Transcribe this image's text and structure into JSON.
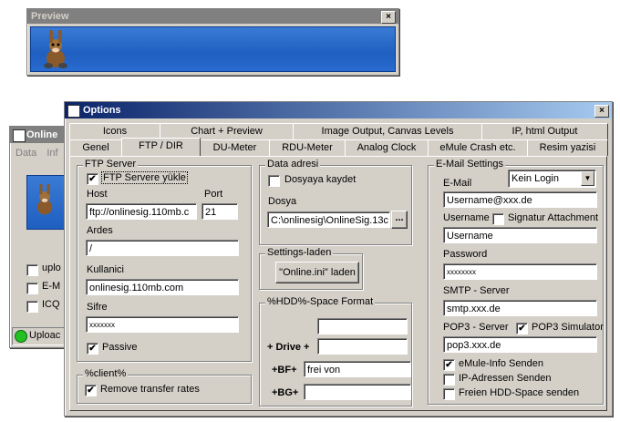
{
  "preview": {
    "title": "Preview",
    "close": "×"
  },
  "online": {
    "title": "Online",
    "menu": [
      "Data",
      "Inf"
    ],
    "checks": [
      "uplo",
      "E-M",
      "ICQ"
    ],
    "status": "Uploac"
  },
  "options": {
    "title": "Options",
    "close": "×",
    "tabs_row1": [
      "Icons",
      "Chart + Preview",
      "Image Output, Canvas Levels",
      "IP, html Output"
    ],
    "tabs_row2": [
      "Genel",
      "FTP / DIR",
      "DU-Meter",
      "RDU-Meter",
      "Analog Clock",
      "eMule Crash etc.",
      "Resim yazisi"
    ],
    "ftp": {
      "group": "FTP Server",
      "enable_label": "FTP Servere yükle",
      "host_label": "Host",
      "host_value": "ftp://onlinesig.110mb.c",
      "port_label": "Port",
      "port_value": "21",
      "ardes_label": "Ardes",
      "ardes_value": "/",
      "user_label": "Kullanici",
      "user_value": "onlinesig.110mb.com",
      "pass_label": "Sifre",
      "pass_value": "xxxxxxx",
      "passive_label": "Passive"
    },
    "client": {
      "group": "%client%",
      "remove_label": "Remove transfer rates"
    },
    "data": {
      "group": "Data adresi",
      "save_label": "Dosyaya kaydet",
      "file_label": "Dosya",
      "file_value": "C:\\onlinesig\\OnlineSig.13c",
      "browse": "..."
    },
    "settings": {
      "group": "Settings-laden",
      "load_button": "\"Online.ini\" laden"
    },
    "hdd": {
      "group": "%HDD%-Space Format",
      "drive_label": "+ Drive +",
      "bf_label": "+BF+",
      "bf_value": "frei von",
      "bg_label": "+BG+"
    },
    "email": {
      "group": "E-Mail Settings",
      "email_label": "E-Mail",
      "login_select": "Kein Login",
      "email_value": "Username@xxx.de",
      "username_label": "Username",
      "signatur_label": "Signatur Attachment",
      "username_value": "Username",
      "password_label": "Password",
      "password_value": "xxxxxxxx",
      "smtp_label": "SMTP - Server",
      "smtp_value": "smtp.xxx.de",
      "pop3_label": "POP3 - Server",
      "pop3_sim_label": "POP3 Simulator",
      "pop3_value": "pop3.xxx.de",
      "emule_info_label": "eMule-Info Senden",
      "ip_label": "IP-Adressen Senden",
      "hdd_label": "Freien HDD-Space senden"
    }
  }
}
